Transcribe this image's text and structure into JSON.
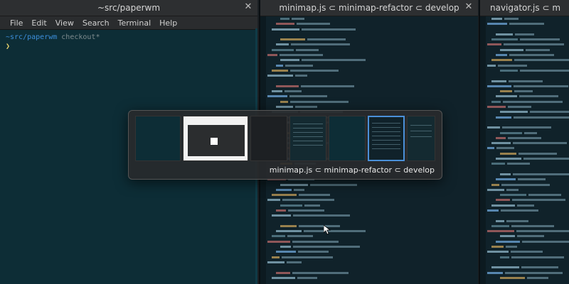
{
  "terminal": {
    "title": "~src/paperwm",
    "menu": [
      "File",
      "Edit",
      "View",
      "Search",
      "Terminal",
      "Help"
    ],
    "prompt_path": "~src/paperwm",
    "prompt_cmd": "checkout*",
    "cursor": "❯"
  },
  "minimap_editor": {
    "title": "minimap.js ⊂ minimap-refactor ⊂ develop"
  },
  "navigator_editor": {
    "title": "navigator.js ⊂ m"
  },
  "switcher": {
    "label": "minimap.js ⊂ minimap-refactor ⊂ develop",
    "thumbnails": [
      "Terminal window",
      "Browser window",
      "Dark window",
      "Code editor",
      "Terminal window 2",
      "minimap.js editor",
      "Code editor 2"
    ]
  },
  "colors": {
    "accent": "#4a90d9",
    "terminal_bg": "#0d2d36",
    "editor_bg": "#10222a"
  }
}
